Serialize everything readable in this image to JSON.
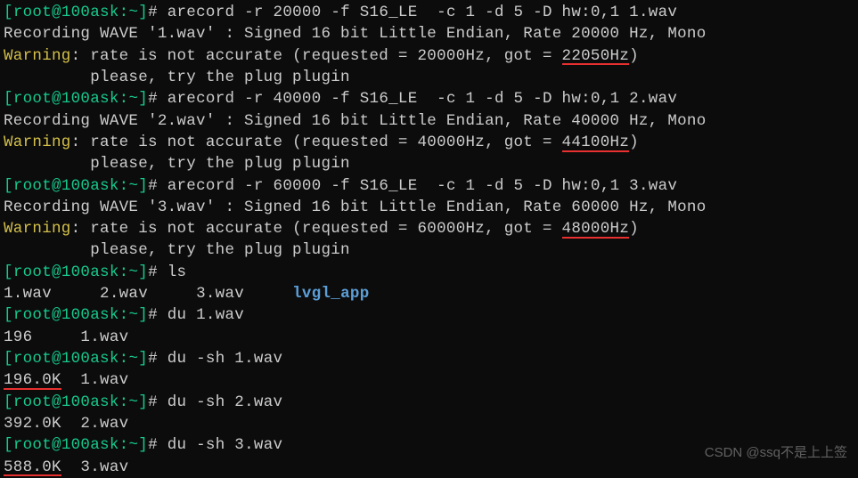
{
  "prompt": {
    "open": "[",
    "user_host": "root@100ask",
    "sep": ":",
    "path": "~",
    "close": "]",
    "hash": "#"
  },
  "cmd": {
    "arecord1": " arecord -r 20000 -f S16_LE  -c 1 -d 5 -D hw:0,1 1.wav",
    "arecord2": " arecord -r 40000 -f S16_LE  -c 1 -d 5 -D hw:0,1 2.wav",
    "arecord3": " arecord -r 60000 -f S16_LE  -c 1 -d 5 -D hw:0,1 3.wav",
    "ls": " ls",
    "du1": " du 1.wav",
    "du2": " du -sh 1.wav",
    "du3": " du -sh 2.wav",
    "du4": " du -sh 3.wav"
  },
  "out": {
    "rec1": "Recording WAVE '1.wav' : Signed 16 bit Little Endian, Rate 20000 Hz, Mono",
    "rec2": "Recording WAVE '2.wav' : Signed 16 bit Little Endian, Rate 40000 Hz, Mono",
    "rec3": "Recording WAVE '3.wav' : Signed 16 bit Little Endian, Rate 60000 Hz, Mono",
    "warn_label": "Warning",
    "warn1_a": ": rate is not accurate (requested = 20000Hz, got = ",
    "warn1_b": "22050Hz",
    "warn1_c": ")",
    "warn2_a": ": rate is not accurate (requested = 40000Hz, got = ",
    "warn2_b": "44100Hz",
    "warn2_c": ")",
    "warn3_a": ": rate is not accurate (requested = 60000Hz, got = ",
    "warn3_b": "48000Hz",
    "warn3_c": ")",
    "warn_tail": "         please, try the plug plugin",
    "ls_1": "1.wav",
    "ls_sp1": "     ",
    "ls_2": "2.wav",
    "ls_sp2": "     ",
    "ls_3": "3.wav",
    "ls_sp3": "     ",
    "ls_4": "lvgl_app",
    "du1_out": "196     1.wav",
    "du2_a": "196.0K",
    "du2_b": "  1.wav",
    "du3_out": "392.0K  2.wav",
    "du4_a": "588.0K",
    "du4_b": "  3.wav"
  },
  "watermark": "CSDN @ssq不是上上签"
}
